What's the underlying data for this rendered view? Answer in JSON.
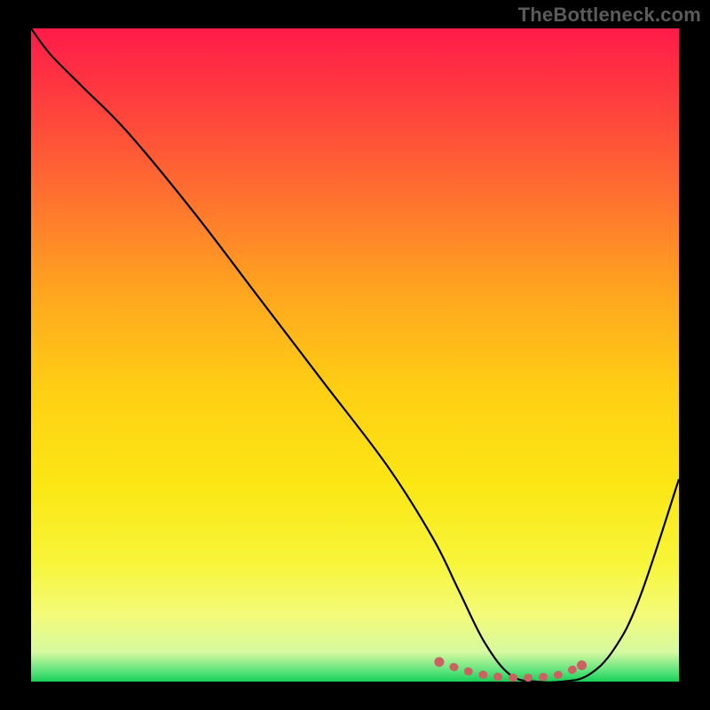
{
  "watermark": "TheBottleneck.com",
  "colors": {
    "curve": "#000000",
    "sweet_spot": "#cc6163",
    "frame_bg": "#000000"
  },
  "gradient_stops": [
    {
      "offset": 0.0,
      "color": "#ff1b49"
    },
    {
      "offset": 0.1,
      "color": "#ff3a3f"
    },
    {
      "offset": 0.25,
      "color": "#ff6e30"
    },
    {
      "offset": 0.4,
      "color": "#ffa41f"
    },
    {
      "offset": 0.55,
      "color": "#ffce14"
    },
    {
      "offset": 0.7,
      "color": "#fbe714"
    },
    {
      "offset": 0.82,
      "color": "#f7f53a"
    },
    {
      "offset": 0.9,
      "color": "#f3fb7a"
    },
    {
      "offset": 0.955,
      "color": "#d6f9a0"
    },
    {
      "offset": 0.985,
      "color": "#58e37a"
    },
    {
      "offset": 1.0,
      "color": "#18cf57"
    }
  ],
  "chart_data": {
    "type": "line",
    "title": "",
    "xlabel": "",
    "ylabel": "",
    "xlim": [
      0,
      100
    ],
    "ylim": [
      0,
      100
    ],
    "x": [
      0,
      3,
      8,
      15,
      25,
      35,
      45,
      55,
      62,
      66,
      70,
      74,
      78,
      82,
      86,
      90,
      94,
      100
    ],
    "y": [
      100,
      96,
      91,
      84,
      72,
      59,
      46,
      33,
      22,
      14,
      6,
      1,
      0,
      0,
      1,
      5,
      13,
      31
    ],
    "sweet_spot": {
      "x": [
        63,
        66,
        69,
        72.5,
        76,
        79,
        82,
        85
      ],
      "y": [
        3.0,
        2.0,
        1.2,
        0.7,
        0.6,
        0.7,
        1.2,
        2.5
      ]
    }
  }
}
